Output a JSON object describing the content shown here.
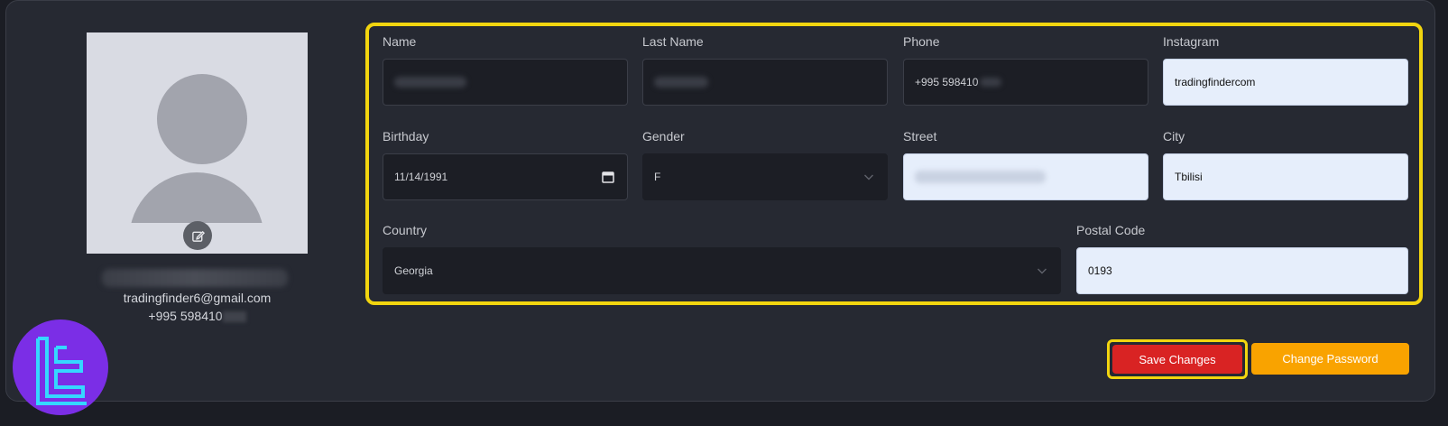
{
  "profile": {
    "email": "tradingfinder6@gmail.com",
    "phone_visible": "+995 598410"
  },
  "form": {
    "name": {
      "label": "Name",
      "value": ""
    },
    "last_name": {
      "label": "Last Name",
      "value": ""
    },
    "phone": {
      "label": "Phone",
      "value": "+995 598410"
    },
    "instagram": {
      "label": "Instagram",
      "value": "tradingfindercom"
    },
    "birthday": {
      "label": "Birthday",
      "value": "11/14/1991"
    },
    "gender": {
      "label": "Gender",
      "value": "F"
    },
    "street": {
      "label": "Street",
      "value": ""
    },
    "city": {
      "label": "City",
      "value": "Tbilisi"
    },
    "country": {
      "label": "Country",
      "value": "Georgia"
    },
    "postal_code": {
      "label": "Postal Code",
      "value": "0193"
    }
  },
  "actions": {
    "save_label": "Save Changes",
    "change_password_label": "Change Password"
  },
  "colors": {
    "highlight": "#f2d50f",
    "save": "#d92323",
    "change_password": "#f9a300",
    "logo_bg": "#7b2ee6",
    "logo_fg": "#35d7ff"
  },
  "icons": {
    "edit": "edit-icon",
    "dropdown": "chevron-down-icon",
    "calendar": "calendar-icon",
    "logo": "tradingfinder-logo"
  }
}
